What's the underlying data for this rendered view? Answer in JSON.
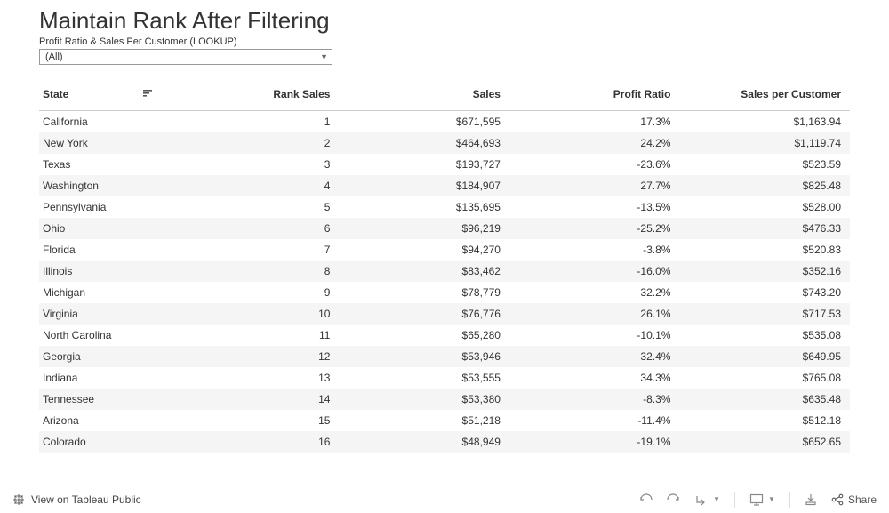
{
  "header": {
    "title": "Maintain Rank After Filtering"
  },
  "filter": {
    "label": "Profit Ratio & Sales Per Customer (LOOKUP)",
    "value": "(All)"
  },
  "table": {
    "columns": {
      "state": "State",
      "rank": "Rank Sales",
      "sales": "Sales",
      "profit_ratio": "Profit Ratio",
      "spc": "Sales per Customer"
    },
    "rows": [
      {
        "state": "California",
        "rank": "1",
        "sales": "$671,595",
        "profit_ratio": "17.3%",
        "spc": "$1,163.94"
      },
      {
        "state": "New York",
        "rank": "2",
        "sales": "$464,693",
        "profit_ratio": "24.2%",
        "spc": "$1,119.74"
      },
      {
        "state": "Texas",
        "rank": "3",
        "sales": "$193,727",
        "profit_ratio": "-23.6%",
        "spc": "$523.59"
      },
      {
        "state": "Washington",
        "rank": "4",
        "sales": "$184,907",
        "profit_ratio": "27.7%",
        "spc": "$825.48"
      },
      {
        "state": "Pennsylvania",
        "rank": "5",
        "sales": "$135,695",
        "profit_ratio": "-13.5%",
        "spc": "$528.00"
      },
      {
        "state": "Ohio",
        "rank": "6",
        "sales": "$96,219",
        "profit_ratio": "-25.2%",
        "spc": "$476.33"
      },
      {
        "state": "Florida",
        "rank": "7",
        "sales": "$94,270",
        "profit_ratio": "-3.8%",
        "spc": "$520.83"
      },
      {
        "state": "Illinois",
        "rank": "8",
        "sales": "$83,462",
        "profit_ratio": "-16.0%",
        "spc": "$352.16"
      },
      {
        "state": "Michigan",
        "rank": "9",
        "sales": "$78,779",
        "profit_ratio": "32.2%",
        "spc": "$743.20"
      },
      {
        "state": "Virginia",
        "rank": "10",
        "sales": "$76,776",
        "profit_ratio": "26.1%",
        "spc": "$717.53"
      },
      {
        "state": "North Carolina",
        "rank": "11",
        "sales": "$65,280",
        "profit_ratio": "-10.1%",
        "spc": "$535.08"
      },
      {
        "state": "Georgia",
        "rank": "12",
        "sales": "$53,946",
        "profit_ratio": "32.4%",
        "spc": "$649.95"
      },
      {
        "state": "Indiana",
        "rank": "13",
        "sales": "$53,555",
        "profit_ratio": "34.3%",
        "spc": "$765.08"
      },
      {
        "state": "Tennessee",
        "rank": "14",
        "sales": "$53,380",
        "profit_ratio": "-8.3%",
        "spc": "$635.48"
      },
      {
        "state": "Arizona",
        "rank": "15",
        "sales": "$51,218",
        "profit_ratio": "-11.4%",
        "spc": "$512.18"
      },
      {
        "state": "Colorado",
        "rank": "16",
        "sales": "$48,949",
        "profit_ratio": "-19.1%",
        "spc": "$652.65"
      }
    ]
  },
  "footer": {
    "view_label": "View on Tableau Public",
    "share_label": "Share"
  }
}
